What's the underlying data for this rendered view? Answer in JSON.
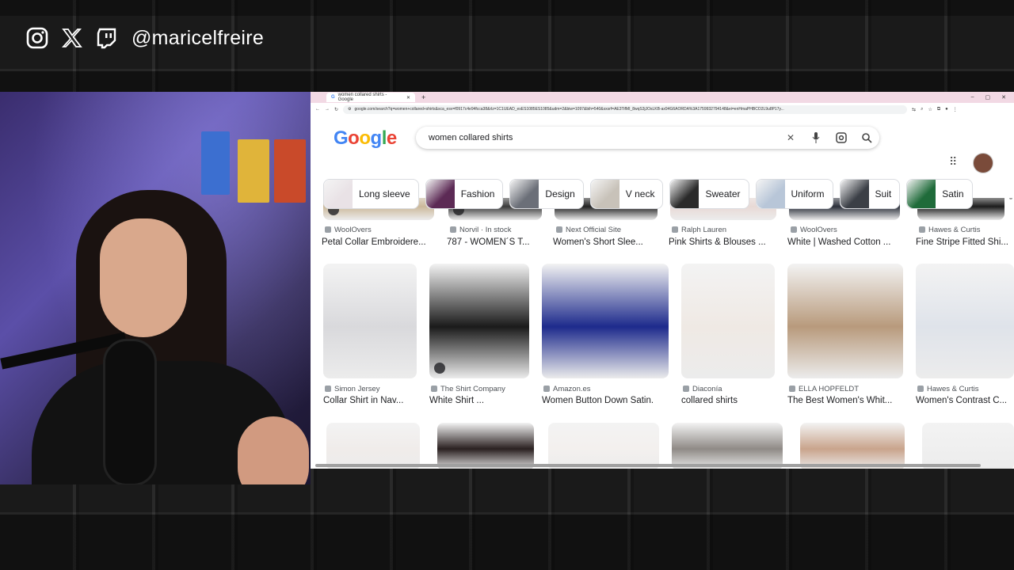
{
  "social": {
    "icons": [
      "instagram-icon",
      "x-icon",
      "twitch-icon"
    ],
    "handle": "@maricelfreire"
  },
  "browser": {
    "tab_title": "women collared shirts - Google",
    "url": "google.com/search?q=women+collared+shirts&sca_esv=f0917c4e94fcca38&rlz=1C1UEAD_esES1085ES1085&udm=2&biw=1097&bih=540&sxsrf=AE3TifMI_8wqS3jJOsLKB-ax94G6AORDA%3A1759932794148&ei=enHmaPHBCO2L9u8P17y..."
  },
  "google": {
    "logo_letters": [
      "G",
      "o",
      "o",
      "g",
      "l",
      "e"
    ],
    "query": "women collared shirts",
    "chips": [
      {
        "label": "Long sleeve",
        "color": "#e9e2e6"
      },
      {
        "label": "Fashion",
        "color": "#5c2a55"
      },
      {
        "label": "Design",
        "color": "#6b6f78"
      },
      {
        "label": "V neck",
        "color": "#c8c2b9"
      },
      {
        "label": "Sweater",
        "color": "#2a2a2a"
      },
      {
        "label": "Uniform",
        "color": "#b8c6d8"
      },
      {
        "label": "Suit",
        "color": "#3b3f46"
      },
      {
        "label": "Satin",
        "color": "#1f6b3a"
      }
    ]
  },
  "results_row1": [
    {
      "source": "WoolOvers",
      "title": "Petal Collar Embroidere...",
      "color": "#cbb89a"
    },
    {
      "source": "Norvil · In stock",
      "title": "787 - WOMEN´S T...",
      "color": "#3b3b3b"
    },
    {
      "source": "Next Official Site",
      "title": "Women's Short Slee...",
      "color": "#222"
    },
    {
      "source": "Ralph Lauren",
      "title": "Pink Shirts & Blouses ...",
      "color": "#e8d9d5"
    },
    {
      "source": "WoolOvers",
      "title": "White | Washed Cotton ...",
      "color": "#2b2f3a"
    },
    {
      "source": "Hawes & Curtis",
      "title": "Fine Stripe Fitted Shi...",
      "color": "#1c1c1c"
    }
  ],
  "results_row2": [
    {
      "source": "Simon Jersey",
      "title": "Collar Shirt in Nav...",
      "color": "#d9d9dc"
    },
    {
      "source": "The Shirt Company",
      "title": "White Shirt ...",
      "color": "#1a1a1a"
    },
    {
      "source": "Amazon.es",
      "title": "Women Button Down Satin...",
      "color": "#1d2a8c"
    },
    {
      "source": "Diaconía",
      "title": "collared shirts",
      "color": "#efe9e4"
    },
    {
      "source": "ELLA HOPFELDT",
      "title": "The Best Women's Whit...",
      "color": "#b89a7c"
    },
    {
      "source": "Hawes & Curtis",
      "title": "Women's Contrast C...",
      "color": "#dfe3ea"
    }
  ],
  "results_row3_colors": [
    "#f0ecea",
    "#2a2020",
    "#f3f0ee",
    "#8f8a86",
    "#c9a48c",
    "#efefef"
  ]
}
